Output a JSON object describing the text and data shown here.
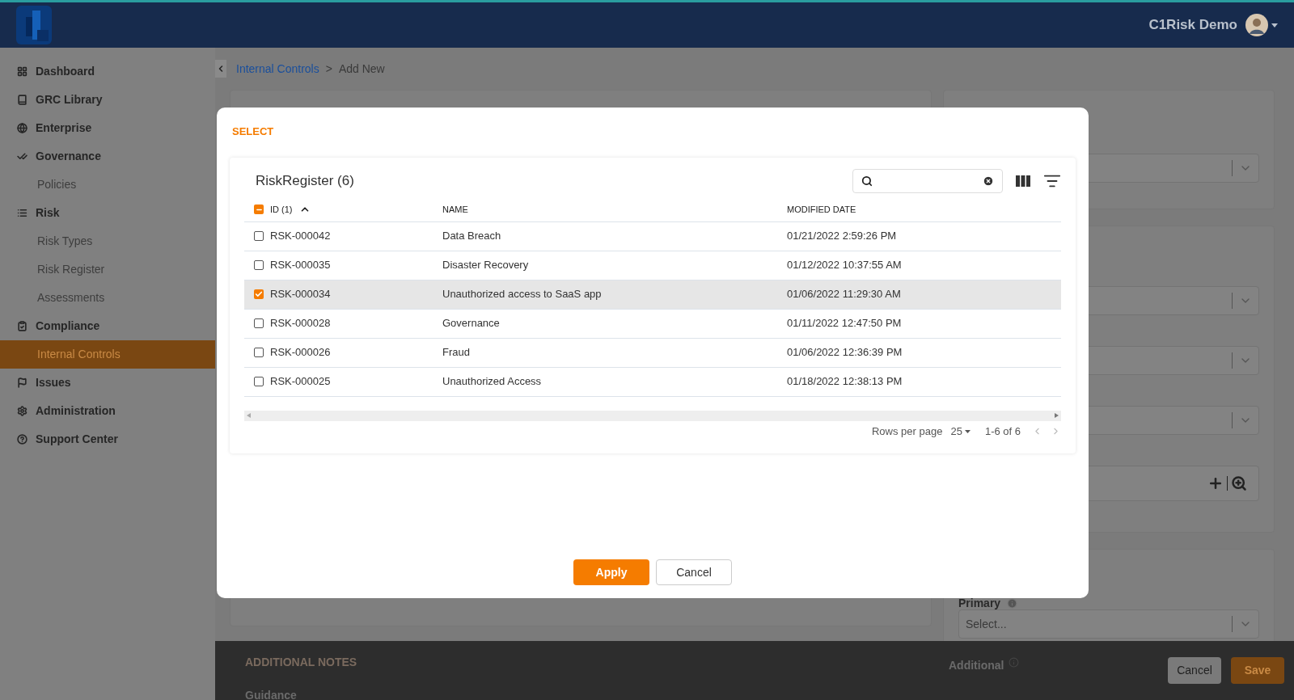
{
  "header": {
    "user": "C1Risk Demo"
  },
  "sidebar": {
    "items": [
      {
        "label": "Dashboard",
        "selected": false
      },
      {
        "label": "GRC Library",
        "selected": false
      },
      {
        "label": "Enterprise",
        "selected": false
      },
      {
        "label": "Governance",
        "selected": false,
        "children": [
          {
            "label": "Policies",
            "selected": false
          }
        ]
      },
      {
        "label": "Risk",
        "selected": false,
        "children": [
          {
            "label": "Risk Types",
            "selected": false
          },
          {
            "label": "Risk Register",
            "selected": false
          },
          {
            "label": "Assessments",
            "selected": false
          }
        ]
      },
      {
        "label": "Compliance",
        "selected": false,
        "children": [
          {
            "label": "Internal Controls",
            "selected": true
          }
        ]
      },
      {
        "label": "Issues",
        "selected": false
      },
      {
        "label": "Administration",
        "selected": false
      },
      {
        "label": "Support Center",
        "selected": false
      }
    ]
  },
  "breadcrumb": {
    "items": [
      "Internal Controls",
      "Add New"
    ],
    "separator": ">"
  },
  "background": {
    "primary_label": "Primary",
    "primary_placeholder": "Select...",
    "notes_heading": "ADDITIONAL NOTES",
    "guidance_label": "Guidance",
    "additional_label": "Additional",
    "buttons": [
      "Cancel",
      "Save"
    ]
  },
  "modal": {
    "title": "SELECT",
    "table_title": "RiskRegister (6)",
    "select_all": {
      "indeterminate": true
    },
    "columns": [
      {
        "label": "ID (1)",
        "sorted": true,
        "descending": false
      },
      {
        "label": "NAME"
      },
      {
        "label": "MODIFIED DATE"
      }
    ],
    "rows": [
      {
        "id": "RSK-000042",
        "name": "Data Breach",
        "modified": "01/21/2022 2:59:26 PM",
        "selected": false
      },
      {
        "id": "RSK-000035",
        "name": "Disaster Recovery",
        "modified": "01/12/2022 10:37:55 AM",
        "selected": false
      },
      {
        "id": "RSK-000034",
        "name": "Unauthorized access to SaaS app",
        "modified": "01/06/2022 11:29:30 AM",
        "selected": true
      },
      {
        "id": "RSK-000028",
        "name": "Governance",
        "modified": "01/11/2022 12:47:50 PM",
        "selected": false
      },
      {
        "id": "RSK-000026",
        "name": "Fraud",
        "modified": "01/06/2022 12:36:39 PM",
        "selected": false
      },
      {
        "id": "RSK-000025",
        "name": "Unauthorized Access",
        "modified": "01/18/2022 12:38:13 PM",
        "selected": false
      }
    ],
    "pagination": {
      "rows_per_page_label": "Rows per page",
      "rows_per_page": "25",
      "range": "1-6 of 6"
    },
    "buttons": {
      "apply": "Apply",
      "cancel": "Cancel"
    }
  }
}
